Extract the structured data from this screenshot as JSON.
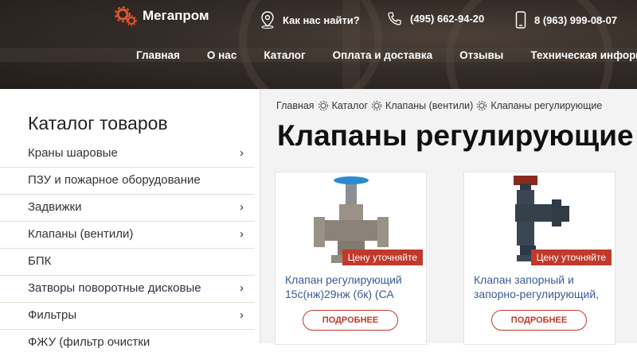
{
  "header": {
    "logo_text": "Мегапром",
    "find_us": "Как нас найти?",
    "phone1": "(495) 662-94-20",
    "phone2": "8 (963) 999-08-07",
    "nav": [
      "Главная",
      "О нас",
      "Каталог",
      "Оплата и доставка",
      "Отзывы",
      "Техническая информация"
    ]
  },
  "sidebar": {
    "title": "Каталог товаров",
    "items": [
      {
        "label": "Краны шаровые",
        "has_children": true
      },
      {
        "label": "ПЗУ и пожарное оборудование",
        "has_children": false
      },
      {
        "label": "Задвижки",
        "has_children": true
      },
      {
        "label": "Клапаны (вентили)",
        "has_children": true
      },
      {
        "label": "БПК",
        "has_children": false
      },
      {
        "label": "Затворы поворотные дисковые",
        "has_children": true
      },
      {
        "label": "Фильтры",
        "has_children": true
      },
      {
        "label": "ФЖУ (фильтр очистки",
        "has_children": false
      }
    ]
  },
  "breadcrumb": [
    "Главная",
    "Каталог",
    "Клапаны (вентили)",
    "Клапаны регулирующие"
  ],
  "page_title": "Клапаны регулирующие",
  "products": [
    {
      "name": "Клапан регулирующий 15с(нж)29нж (бк) (СА",
      "price_label": "Цену уточняйте",
      "button": "ПОДРОБНЕЕ"
    },
    {
      "name": "Клапан запорный и запорно-регулирующий,",
      "price_label": "Цену уточняйте",
      "button": "ПОДРОБНЕЕ"
    }
  ],
  "colors": {
    "accent": "#c0392b",
    "link": "#3a5a96"
  },
  "icons": {
    "logo": "gear-icon",
    "location": "map-pin-icon",
    "phone": "phone-icon",
    "mobile": "mobile-icon",
    "chevron": "chevron-right-icon",
    "breadcrumb_sep": "gear-icon"
  }
}
